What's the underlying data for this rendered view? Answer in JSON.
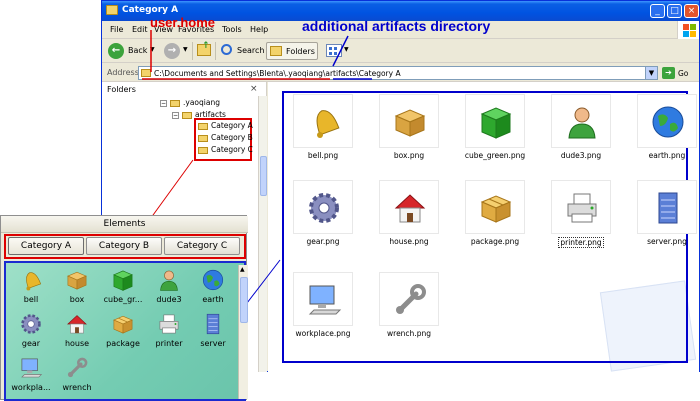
{
  "window": {
    "title": "Category A",
    "title_buttons": [
      "_",
      "□",
      "×"
    ],
    "menu": [
      "File",
      "Edit",
      "View",
      "Favorites",
      "Tools",
      "Help"
    ],
    "toolbar": {
      "back": "Back",
      "search": "Search",
      "folders": "Folders"
    },
    "address": {
      "label": "Address",
      "path": "C:\\Documents and Settings\\Blenta\\.yaoqiang\\artifacts\\Category A",
      "go": "Go"
    },
    "folders_pane": {
      "title": "Folders",
      "close": "×",
      "tree": [
        ".yaoqiang",
        "artifacts",
        "Category A",
        "Category B",
        "Category C"
      ]
    },
    "files": [
      {
        "name": "bell.png",
        "icon": "bell-icon"
      },
      {
        "name": "box.png",
        "icon": "box-icon"
      },
      {
        "name": "cube_green.png",
        "icon": "cube-icon"
      },
      {
        "name": "dude3.png",
        "icon": "person-icon"
      },
      {
        "name": "earth.png",
        "icon": "globe-icon"
      },
      {
        "name": "gear.png",
        "icon": "gear-icon"
      },
      {
        "name": "house.png",
        "icon": "house-icon"
      },
      {
        "name": "package.png",
        "icon": "package-icon"
      },
      {
        "name": "printer.png",
        "icon": "printer-icon",
        "selected": true
      },
      {
        "name": "server.png",
        "icon": "server-icon"
      },
      {
        "name": "workplace.png",
        "icon": "workstation-icon"
      },
      {
        "name": "wrench.png",
        "icon": "wrench-icon"
      }
    ]
  },
  "annotations": {
    "user_home": "user.home",
    "artifacts_dir": "additional artifacts directory"
  },
  "panel": {
    "title": "Elements",
    "tabs": [
      "Category A",
      "Category B",
      "Category C"
    ],
    "items": [
      "bell",
      "box",
      "cube_gr...",
      "dude3",
      "earth",
      "gear",
      "house",
      "package",
      "printer",
      "server",
      "workpla...",
      "wrench"
    ]
  },
  "colors": {
    "annotation_red": "#dd0000",
    "annotation_blue": "#0000cc",
    "panel_bg": "#74ccb2",
    "titlebar": "#0053e1"
  }
}
